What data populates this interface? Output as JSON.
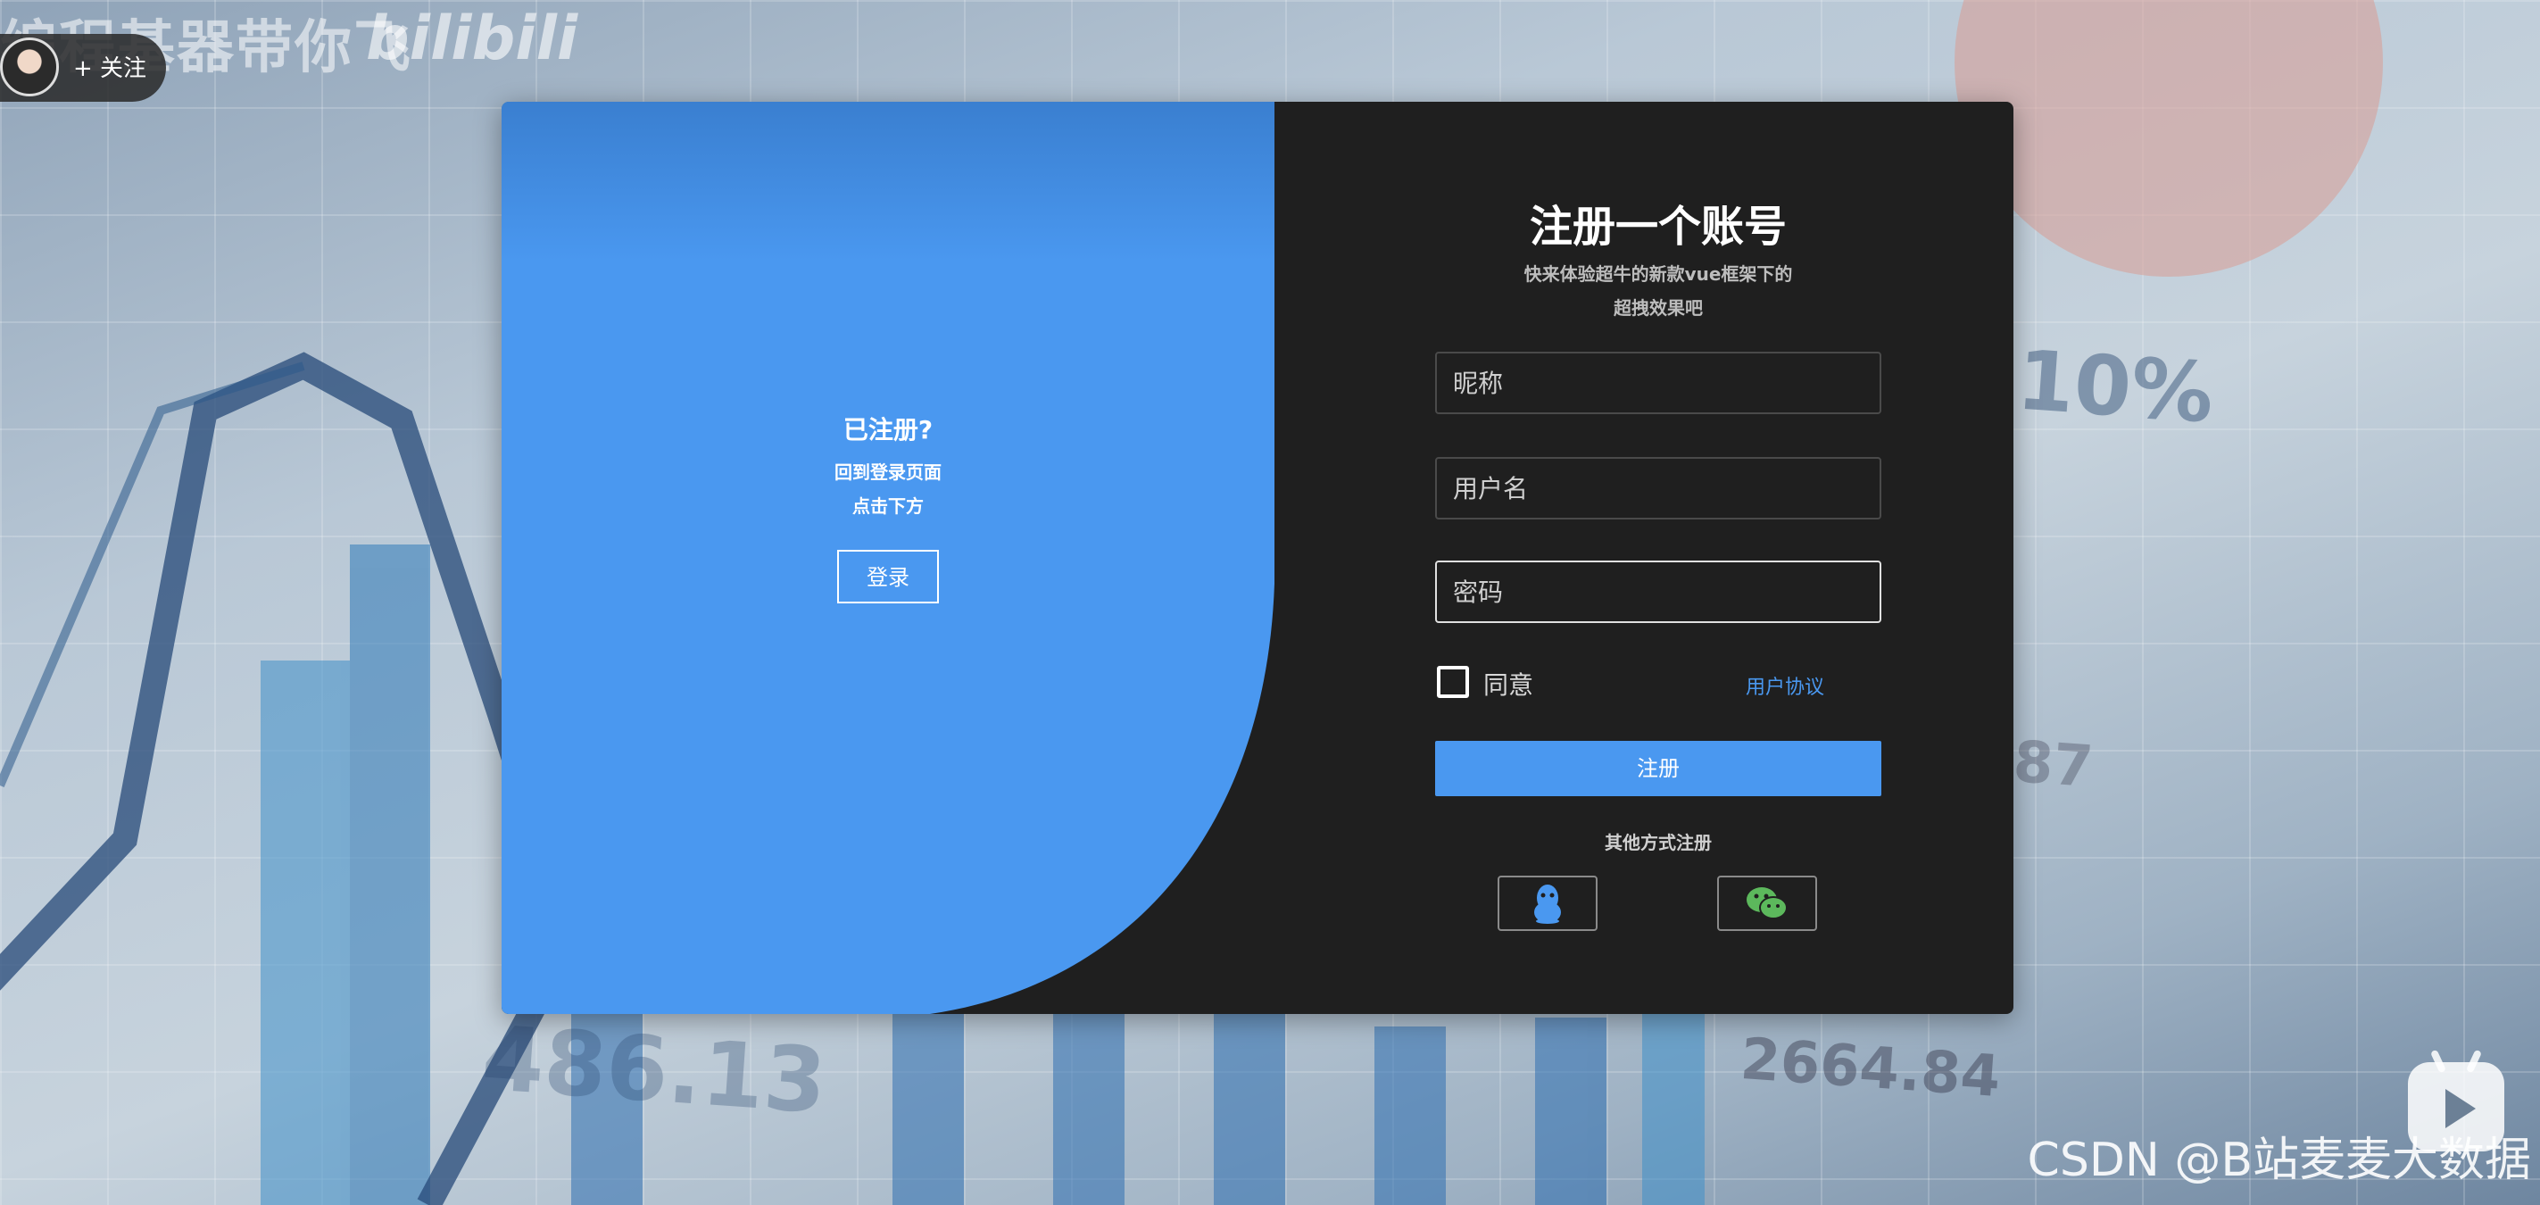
{
  "video": {
    "watermark": "编程基器带你飞",
    "platform_logo": "bilibili",
    "follow_label": "+ 关注",
    "csdn_watermark": "CSDN @B站麦麦大数据"
  },
  "background": {
    "numbers": [
      "10%",
      "486.13",
      "2664.84",
      "87"
    ]
  },
  "login_panel": {
    "title": "已注册?",
    "line1": "回到登录页面",
    "line2": "点击下方",
    "login_button": "登录"
  },
  "register_form": {
    "heading": "注册一个账号",
    "desc_line1": "快来体验超牛的新款vue框架下的",
    "desc_line2": "超拽效果吧",
    "nickname_placeholder": "昵称",
    "username_placeholder": "用户名",
    "password_placeholder": "密码",
    "agree_label": "同意",
    "terms_link": "用户协议",
    "submit_label": "注册",
    "other_methods_label": "其他方式注册",
    "social": [
      {
        "name": "qq-icon",
        "color": "#4a98f0"
      },
      {
        "name": "wechat-icon",
        "color": "#5cb85c"
      }
    ]
  },
  "colors": {
    "accent": "#4a98f0",
    "modal_bg": "#1f1f1f"
  }
}
